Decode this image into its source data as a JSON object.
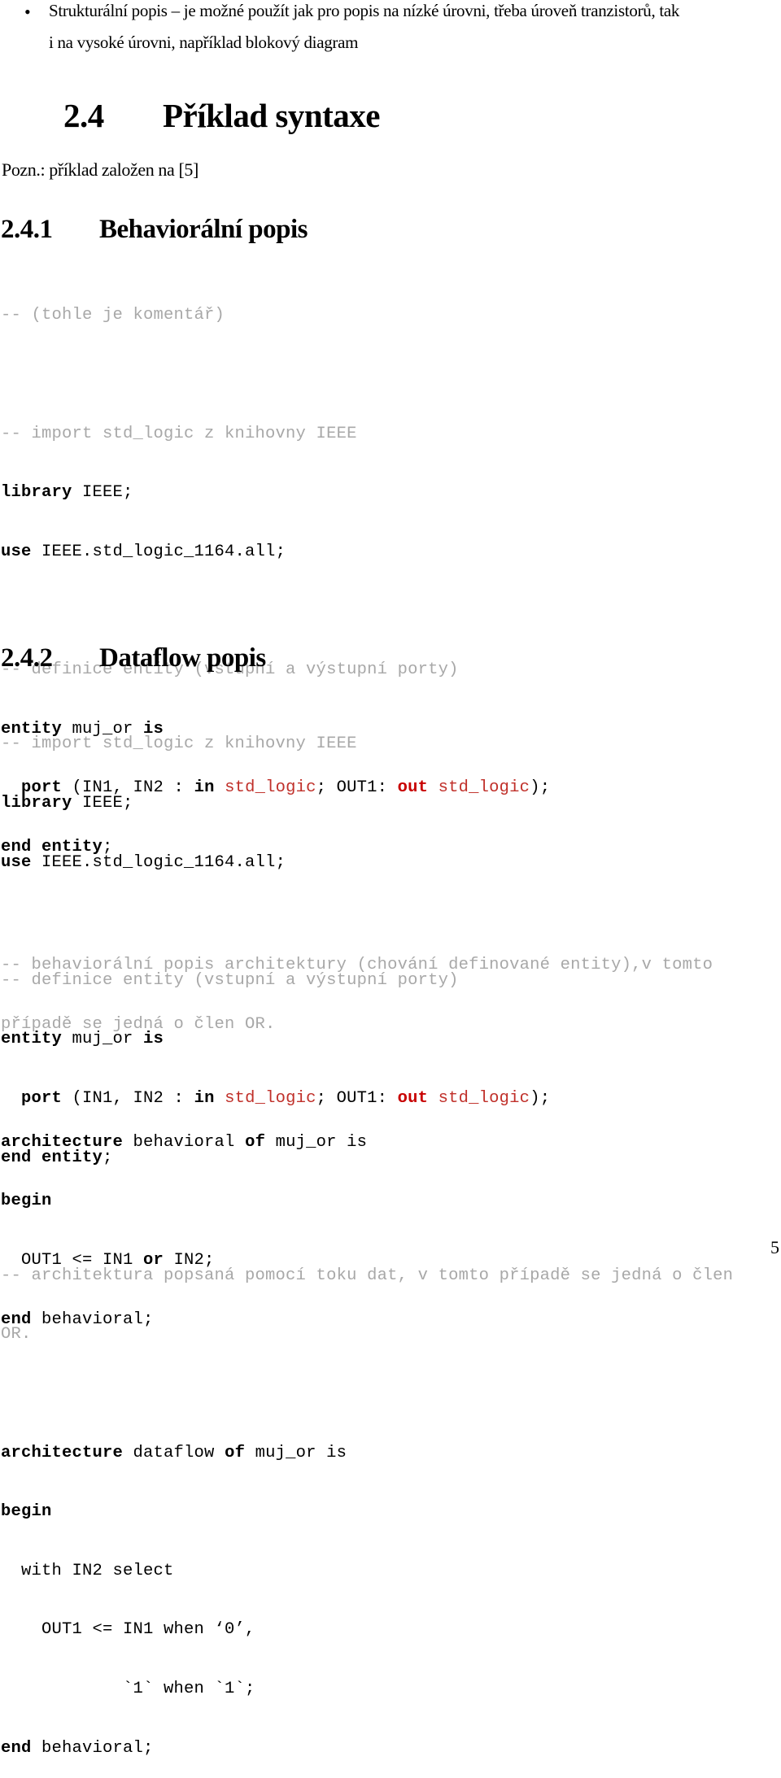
{
  "bullet_item": {
    "line1": "Strukturální popis – je možné použít jak pro popis na nízké úrovni, třeba úroveň tranzistorů, tak",
    "line2": "i na vysoké úrovni, například blokový diagram"
  },
  "section": {
    "number": "2.4",
    "title": "Příklad syntaxe"
  },
  "note": "Pozn.: příklad založen na [5]",
  "subsection_1": {
    "number": "2.4.1",
    "title": "Behaviorální popis",
    "code": {
      "comment_intro": "-- (tohle je komentář)",
      "comment_import": "-- import std_logic z knihovny IEEE",
      "library_kw": "library",
      "library_rest": " IEEE;",
      "use_kw": "use",
      "use_rest": " IEEE.std_logic_1164.all;",
      "comment_entity": "-- definice entity (vstupní a výstupní porty)",
      "entity_kw": "entity",
      "entity_name": " muj_or ",
      "is_kw": "is",
      "port_indent": "  ",
      "port_kw": "port",
      "port_args": " (IN1, IN2 : ",
      "in_kw": "in",
      "type1": " std_logic",
      "port_mid": "; OUT1: ",
      "out_kw": "out",
      "type2": " std_logic",
      "port_end": ");",
      "end_kw": "end",
      "end_entity_kw": " entity",
      "end_entity_semi": ";",
      "comment_arch_1": "-- behaviorální popis architektury (chování definované entity),v tomto",
      "comment_arch_2": "případě se jedná o člen OR.",
      "arch_kw": "architecture",
      "arch_name": " behavioral ",
      "of_kw": "of",
      "arch_rest": " muj_or is",
      "begin_kw": "begin",
      "stmt_a": "  OUT1 <= IN1 ",
      "or_kw": "or",
      "stmt_b": " IN2;",
      "end_arch_kw": "end",
      "end_arch_rest": " behavioral;"
    }
  },
  "subsection_2": {
    "number": "2.4.2",
    "title": "Dataflow popis",
    "code": {
      "comment_import": "-- import std_logic z knihovny IEEE",
      "library_kw": "library",
      "library_rest": " IEEE;",
      "use_kw": "use",
      "use_rest": " IEEE.std_logic_1164.all;",
      "comment_entity": "-- definice entity (vstupní a výstupní porty)",
      "entity_kw": "entity",
      "entity_name": " muj_or ",
      "is_kw": "is",
      "port_indent": "  ",
      "port_kw": "port",
      "port_args": " (IN1, IN2 : ",
      "in_kw": "in",
      "type1": " std_logic",
      "port_mid": "; OUT1: ",
      "out_kw": "out",
      "type2": " std_logic",
      "port_end": ");",
      "end_kw": "end",
      "end_entity_kw": " entity",
      "end_entity_semi": ";",
      "comment_arch_1": "-- architektura popsaná pomocí toku dat, v tomto případě se jedná o člen",
      "comment_arch_2": "OR.",
      "arch_kw": "architecture",
      "arch_name": " dataflow ",
      "of_kw": "of",
      "arch_rest": " muj_or is",
      "begin_kw": "begin",
      "select_line": "  with IN2 select",
      "when_line_1": "    OUT1 <= IN1 when ‘0’,",
      "when_line_2": "            `1` when `1`;",
      "end_arch_kw": "end",
      "end_arch_rest": " behavioral;"
    }
  },
  "page_number": "5"
}
